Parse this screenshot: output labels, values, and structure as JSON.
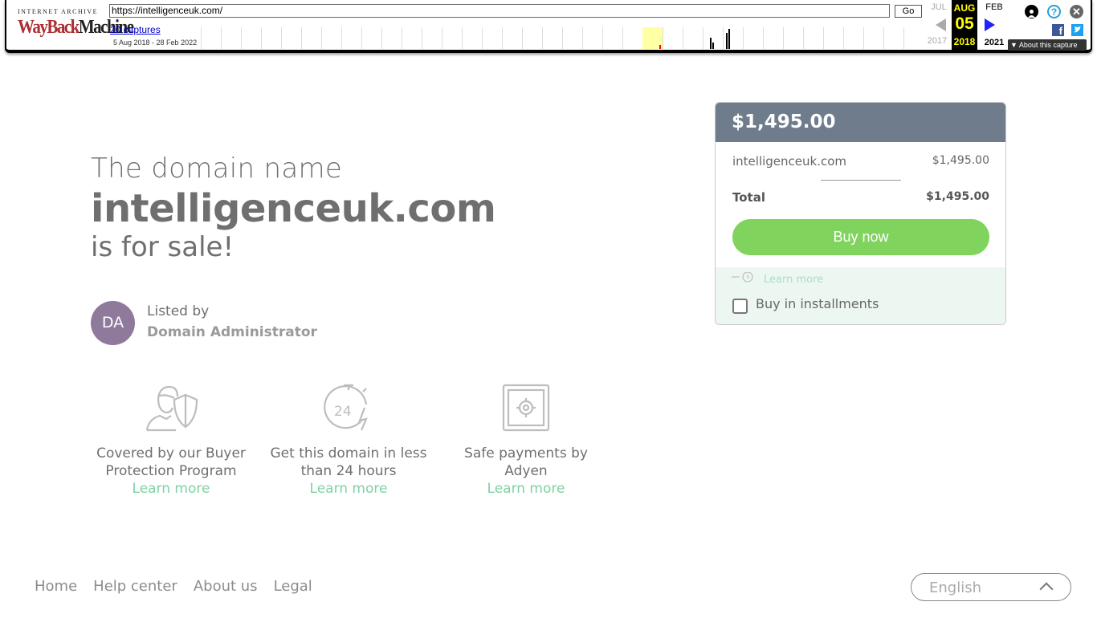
{
  "wayback": {
    "logo_top": "INTERNET ARCHIVE",
    "logo_part1": "WayBack",
    "logo_part2": "Machine",
    "url": "https://intelligenceuk.com/",
    "go_label": "Go",
    "captures_label": "20 captures",
    "date_range": "5 Aug 2018 - 28 Feb 2022",
    "prev_month": "JUL",
    "prev_year": "2017",
    "cur_month": "AUG",
    "cur_day": "05",
    "cur_year": "2018",
    "next_month": "FEB",
    "next_year": "2021",
    "about_label": "▼ About this capture"
  },
  "hero": {
    "line1": "The domain name",
    "domain": "intelligenceuk.com",
    "line3": "is for sale!"
  },
  "seller": {
    "initials": "DA",
    "label": "Listed by",
    "name": "Domain Administrator",
    "avatar_color": "#8f7a9c"
  },
  "features": [
    {
      "icon": "buyer-protection-icon",
      "text_line1": "Covered by our Buyer",
      "text_line2": "Protection Program",
      "link": "Learn more"
    },
    {
      "icon": "24-hours-icon",
      "text_line1": "Get this domain in less",
      "text_line2": "than 24 hours",
      "link": "Learn more"
    },
    {
      "icon": "safe-icon",
      "text_line1": "Safe payments by",
      "text_line2": "Adyen",
      "link": "Learn more"
    }
  ],
  "card": {
    "price": "$1,495.00",
    "item_name": "intelligenceuk.com",
    "item_price": "$1,495.00",
    "total_label": "Total",
    "total_price": "$1,495.00",
    "buy_label": "Buy now",
    "foot_link": "Learn more",
    "installments_label": "Buy in installments",
    "head_color": "#6e7c8c",
    "button_color": "#80d35c"
  },
  "footer": {
    "links": [
      "Home",
      "Help center",
      "About us",
      "Legal"
    ],
    "language": "English"
  }
}
